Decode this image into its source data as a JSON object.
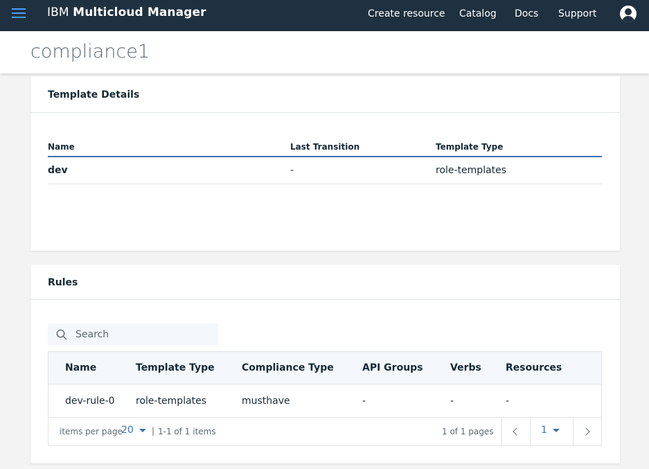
{
  "header": {
    "brand_light": "IBM",
    "brand_bold": "Multicloud Manager",
    "nav": [
      "Create resource",
      "Catalog",
      "Docs",
      "Support"
    ]
  },
  "page": {
    "title": "compliance1"
  },
  "template_details": {
    "title": "Template Details",
    "columns": [
      "Name",
      "Last Transition",
      "Template Type"
    ],
    "rows": [
      [
        "dev",
        "-",
        "role-templates"
      ]
    ]
  },
  "rules": {
    "title": "Rules",
    "search_placeholder": "Search",
    "columns": [
      "Name",
      "Template Type",
      "Compliance Type",
      "API Groups",
      "Verbs",
      "Resources"
    ],
    "rows": [
      [
        "dev-rule-0",
        "role-templates",
        "musthave",
        "-",
        "-",
        "-"
      ]
    ],
    "pagination": {
      "items_per_page_label": "items per page",
      "items_per_page": "20",
      "separator": "|",
      "range": "1-1 of 1 items",
      "pages_text": "1 of 1 pages",
      "current_page": "1"
    }
  },
  "colors": {
    "header_bg": "#1f3140",
    "accent": "#3d70b2",
    "menu_icon": "#4a9eff"
  }
}
